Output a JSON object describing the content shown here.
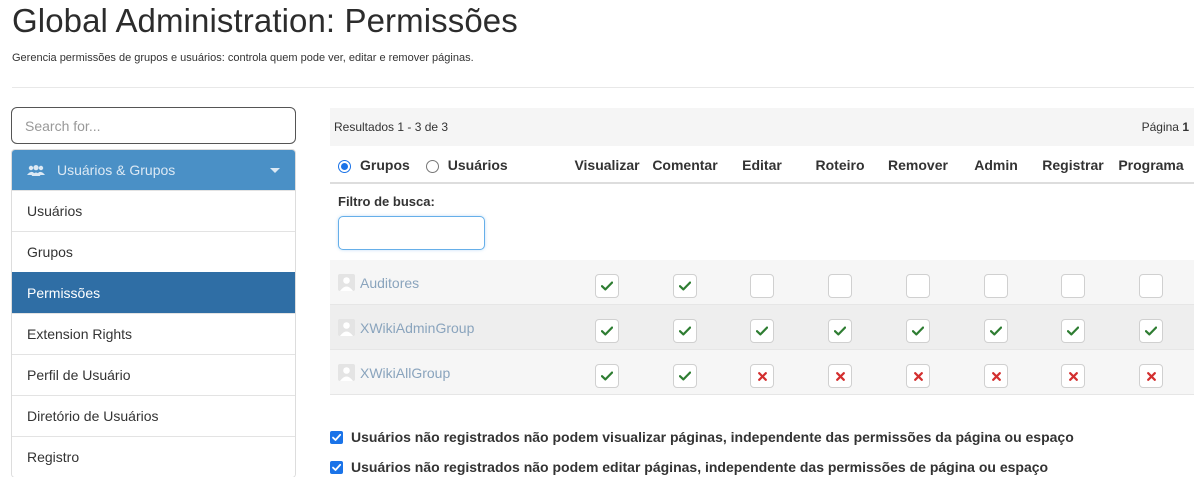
{
  "header": {
    "title": "Global Administration: Permissões",
    "description": "Gerencia permissões de grupos e usuários: controla quem pode ver, editar e remover páginas."
  },
  "sidebar": {
    "search_placeholder": "Search for...",
    "section_label": "Usuários & Grupos",
    "items": [
      {
        "label": "Usuários",
        "active": false
      },
      {
        "label": "Grupos",
        "active": false
      },
      {
        "label": "Permissões",
        "active": true
      },
      {
        "label": "Extension Rights",
        "active": false
      },
      {
        "label": "Perfil de Usuário",
        "active": false
      },
      {
        "label": "Diretório de Usuários",
        "active": false
      },
      {
        "label": "Registro",
        "active": false
      }
    ]
  },
  "table": {
    "results_text": "Resultados 1 - 3 de 3",
    "page_label": "Página",
    "page_number": "1",
    "radio_groups": "Grupos",
    "radio_users": "Usuários",
    "columns": [
      "Visualizar",
      "Comentar",
      "Editar",
      "Roteiro",
      "Remover",
      "Admin",
      "Registrar",
      "Programa"
    ],
    "filter_label": "Filtro de busca:",
    "filter_value": "",
    "rows": [
      {
        "name": "Auditores",
        "rights": [
          "allow",
          "allow",
          "none",
          "none",
          "none",
          "none",
          "none",
          "none"
        ]
      },
      {
        "name": "XWikiAdminGroup",
        "rights": [
          "allow",
          "allow",
          "allow",
          "allow",
          "allow",
          "allow",
          "allow",
          "allow"
        ]
      },
      {
        "name": "XWikiAllGroup",
        "rights": [
          "allow",
          "allow",
          "deny",
          "deny",
          "deny",
          "deny",
          "deny",
          "deny"
        ]
      }
    ]
  },
  "options": [
    {
      "label": "Usuários não registrados não podem visualizar páginas, independente das permissões da página ou espaço",
      "checked": true
    },
    {
      "label": "Usuários não registrados não podem editar páginas, independente das permissões de página ou espaço",
      "checked": true
    }
  ],
  "colors": {
    "accent": "#2f6ea5",
    "menu_header": "#4a90c6",
    "allow": "#2e7d32",
    "deny": "#d32f2f"
  }
}
